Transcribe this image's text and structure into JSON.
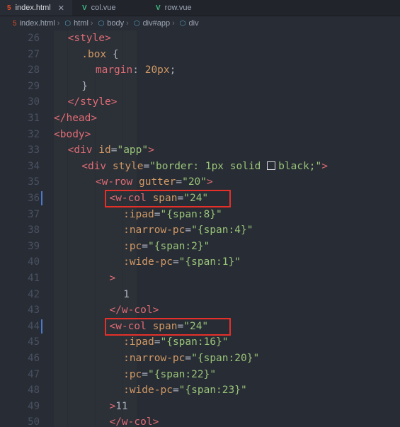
{
  "tabs": [
    {
      "label": "index.html",
      "icon": "html5-icon",
      "active": true,
      "close": "✕"
    },
    {
      "label": "col.vue",
      "icon": "vue-icon",
      "active": false
    },
    {
      "label": "row.vue",
      "icon": "vue-icon",
      "active": false
    }
  ],
  "breadcrumb": [
    "index.html",
    "html",
    "body",
    "div#app",
    "div"
  ],
  "lines": [
    {
      "n": "26",
      "indent": 1,
      "parts": [
        [
          "tag",
          "<style>"
        ]
      ]
    },
    {
      "n": "27",
      "indent": 2,
      "parts": [
        [
          "sel",
          ".box"
        ],
        [
          "pun",
          " {"
        ]
      ]
    },
    {
      "n": "28",
      "indent": 3,
      "parts": [
        [
          "prop",
          "margin"
        ],
        [
          "pun",
          ": "
        ],
        [
          "attr",
          "20px"
        ],
        [
          "pun",
          ";"
        ]
      ]
    },
    {
      "n": "29",
      "indent": 2,
      "parts": [
        [
          "pun",
          "}"
        ]
      ]
    },
    {
      "n": "30",
      "indent": 1,
      "parts": [
        [
          "tag",
          "</style>"
        ]
      ]
    },
    {
      "n": "31",
      "indent": 0,
      "parts": [
        [
          "tag",
          "</head>"
        ]
      ]
    },
    {
      "n": "32",
      "indent": 0,
      "parts": [
        [
          "tag",
          "<body>"
        ]
      ]
    },
    {
      "n": "33",
      "indent": 1,
      "parts": [
        [
          "tag",
          "<div "
        ],
        [
          "attr",
          "id"
        ],
        [
          "pun",
          "="
        ],
        [
          "str",
          "\"app\""
        ],
        [
          "tag",
          ">"
        ]
      ]
    },
    {
      "n": "34",
      "indent": 2,
      "parts": [
        [
          "tag",
          "<div "
        ],
        [
          "attr",
          "style"
        ],
        [
          "pun",
          "="
        ],
        [
          "str",
          "\"border: 1px solid "
        ],
        [
          "box",
          ""
        ],
        [
          "str",
          "black;\""
        ],
        [
          "tag",
          ">"
        ]
      ]
    },
    {
      "n": "35",
      "indent": 3,
      "parts": [
        [
          "tag",
          "<w-row "
        ],
        [
          "attr",
          "gutter"
        ],
        [
          "pun",
          "="
        ],
        [
          "str",
          "\"20\""
        ],
        [
          "tag",
          ">"
        ]
      ]
    },
    {
      "n": "36",
      "indent": 4,
      "parts": [
        [
          "tag",
          "<w-col "
        ],
        [
          "attr",
          "span"
        ],
        [
          "pun",
          "="
        ],
        [
          "str",
          "\"24\""
        ]
      ]
    },
    {
      "n": "37",
      "indent": 5,
      "parts": [
        [
          "attr",
          ":ipad"
        ],
        [
          "pun",
          "="
        ],
        [
          "str",
          "\"{span:8}\""
        ]
      ]
    },
    {
      "n": "38",
      "indent": 5,
      "parts": [
        [
          "attr",
          ":narrow-pc"
        ],
        [
          "pun",
          "="
        ],
        [
          "str",
          "\"{span:4}\""
        ]
      ]
    },
    {
      "n": "39",
      "indent": 5,
      "parts": [
        [
          "attr",
          ":pc"
        ],
        [
          "pun",
          "="
        ],
        [
          "str",
          "\"{span:2}\""
        ]
      ]
    },
    {
      "n": "40",
      "indent": 5,
      "parts": [
        [
          "attr",
          ":wide-pc"
        ],
        [
          "pun",
          "="
        ],
        [
          "str",
          "\"{span:1}\""
        ]
      ]
    },
    {
      "n": "41",
      "indent": 4,
      "parts": [
        [
          "tag",
          ">"
        ]
      ]
    },
    {
      "n": "42",
      "indent": 5,
      "parts": [
        [
          "txt",
          "1"
        ]
      ]
    },
    {
      "n": "43",
      "indent": 4,
      "parts": [
        [
          "tag",
          "</w-col>"
        ]
      ]
    },
    {
      "n": "44",
      "indent": 4,
      "parts": [
        [
          "tag",
          "<w-col "
        ],
        [
          "attr",
          "span"
        ],
        [
          "pun",
          "="
        ],
        [
          "str",
          "\"24\""
        ]
      ]
    },
    {
      "n": "45",
      "indent": 5,
      "parts": [
        [
          "attr",
          ":ipad"
        ],
        [
          "pun",
          "="
        ],
        [
          "str",
          "\"{span:16}\""
        ]
      ]
    },
    {
      "n": "46",
      "indent": 5,
      "parts": [
        [
          "attr",
          ":narrow-pc"
        ],
        [
          "pun",
          "="
        ],
        [
          "str",
          "\"{span:20}\""
        ]
      ]
    },
    {
      "n": "47",
      "indent": 5,
      "parts": [
        [
          "attr",
          ":pc"
        ],
        [
          "pun",
          "="
        ],
        [
          "str",
          "\"{span:22}\""
        ]
      ]
    },
    {
      "n": "48",
      "indent": 5,
      "parts": [
        [
          "attr",
          ":wide-pc"
        ],
        [
          "pun",
          "="
        ],
        [
          "str",
          "\"{span:23}\""
        ]
      ]
    },
    {
      "n": "49",
      "indent": 4,
      "parts": [
        [
          "tag",
          ">"
        ],
        [
          "txt",
          "11"
        ]
      ]
    },
    {
      "n": "50",
      "indent": 4,
      "parts": [
        [
          "tag",
          "</w-col>"
        ]
      ]
    }
  ],
  "colors": {
    "editor_bg": "#282c34",
    "tab_bg": "#21252b",
    "highlight_box": "#e5302a",
    "tag": "#e06c75",
    "attr": "#d19a66",
    "string": "#98c379"
  }
}
